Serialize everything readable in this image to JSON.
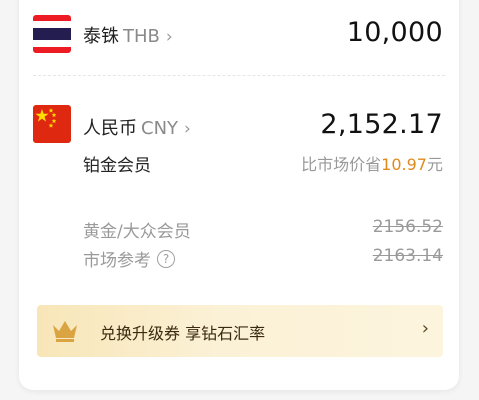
{
  "thb": {
    "name": "泰铢",
    "code": "THB",
    "chevron": "›",
    "amount": "10,000",
    "flag_icon": "thailand-flag-icon",
    "flag_colors": [
      "#ED1C24",
      "#FFFFFF",
      "#241D4F"
    ]
  },
  "cny": {
    "name": "人民币",
    "code": "CNY",
    "chevron": "›",
    "amount": "2,152.17",
    "flag_icon": "china-flag-icon",
    "flag_colors": [
      "#DE2910",
      "#FFDE00"
    ]
  },
  "member": {
    "label": "铂金会员",
    "savings_prefix": "比市场价省",
    "savings_amount": "10.97",
    "savings_unit": "元",
    "highlight_color": "#E08A1C"
  },
  "reference": [
    {
      "label": "黄金/大众会员",
      "value": "2156.52",
      "has_help": false
    },
    {
      "label": "市场参考",
      "value": "2163.14",
      "has_help": true,
      "help_icon_label": "?"
    }
  ],
  "banner": {
    "text": "兑换升级券 享钻石汇率",
    "chevron": "›",
    "icon": "crown-icon",
    "gradient": [
      "#F8E6B8",
      "#FDF4DE"
    ]
  }
}
